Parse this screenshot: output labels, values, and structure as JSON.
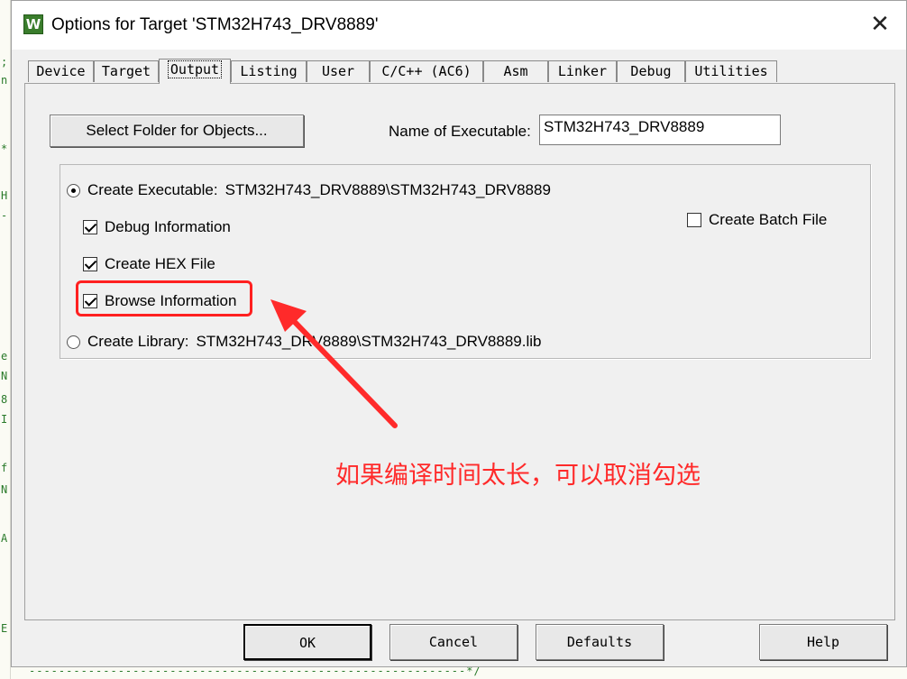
{
  "window": {
    "title": "Options for Target 'STM32H743_DRV8889'",
    "close_symbol": "✕",
    "icon_letter": "W"
  },
  "tabs": [
    {
      "label": "Device"
    },
    {
      "label": "Target"
    },
    {
      "label": "Output",
      "active": true
    },
    {
      "label": "Listing"
    },
    {
      "label": "User"
    },
    {
      "label": "C/C++ (AC6)"
    },
    {
      "label": "Asm"
    },
    {
      "label": "Linker"
    },
    {
      "label": "Debug"
    },
    {
      "label": "Utilities"
    }
  ],
  "output": {
    "select_folder_button": "Select Folder for Objects...",
    "name_label": "Name of Executable:",
    "name_value": "STM32H743_DRV8889",
    "create_executable": {
      "label": "Create Executable:",
      "path": "STM32H743_DRV8889\\STM32H743_DRV8889",
      "selected": true
    },
    "debug_information": {
      "label": "Debug Information",
      "checked": true
    },
    "create_hex_file": {
      "label": "Create HEX File",
      "checked": true
    },
    "browse_information": {
      "label": "Browse Information",
      "checked": true
    },
    "create_batch_file": {
      "label": "Create Batch File",
      "checked": false
    },
    "create_library": {
      "label": "Create Library:",
      "path": "STM32H743_DRV8889\\STM32H743_DRV8889.lib",
      "selected": false
    }
  },
  "annotation": {
    "text": "如果编译时间太长，可以取消勾选",
    "color": "#ff2a2a"
  },
  "buttons": {
    "ok": "OK",
    "cancel": "Cancel",
    "defaults": "Defaults",
    "help": "Help"
  },
  "background_editor": {
    "left_chars": [
      ";",
      "n",
      "*",
      "H",
      "-",
      "e",
      "N",
      "8",
      "I",
      "f",
      "N",
      "A",
      "E"
    ],
    "bottom_line": "-----------------------------------------------------------*/"
  }
}
